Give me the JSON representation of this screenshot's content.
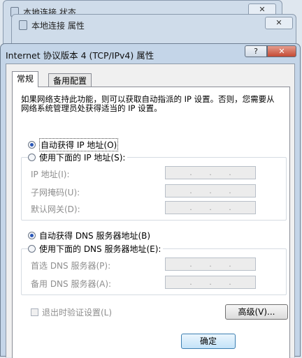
{
  "background_windows": [
    {
      "title": "本地连接 状态",
      "close_label": "✕"
    },
    {
      "title": "本地连接 属性",
      "close_label": "✕"
    }
  ],
  "dialog": {
    "title": "Internet 协议版本 4 (TCP/IPv4) 属性",
    "help_label": "?",
    "close_label": "✕"
  },
  "tabs": [
    {
      "label": "常规",
      "active": true
    },
    {
      "label": "备用配置",
      "active": false
    }
  ],
  "general": {
    "description": "如果网络支持此功能，则可以获取自动指派的 IP 设置。否则，您需要从网络系统管理员处获得适当的 IP 设置。",
    "ip_auto_label": "自动获得 IP 地址(O)",
    "ip_manual_label": "使用下面的 IP 地址(S):",
    "ip_fields": [
      {
        "label": "IP 地址(I):",
        "value": ". . ."
      },
      {
        "label": "子网掩码(U):",
        "value": ". . ."
      },
      {
        "label": "默认网关(D):",
        "value": ". . ."
      }
    ],
    "dns_auto_label": "自动获得 DNS 服务器地址(B)",
    "dns_manual_label": "使用下面的 DNS 服务器地址(E):",
    "dns_fields": [
      {
        "label": "首选 DNS 服务器(P):",
        "value": ". . ."
      },
      {
        "label": "备用 DNS 服务器(A):",
        "value": ". . ."
      }
    ],
    "validate_label": "退出时验证设置(L)",
    "advanced_label": "高级(V)...",
    "ok_label": "确定"
  },
  "state": {
    "ip_mode": "auto",
    "dns_mode": "auto",
    "validate_checked": false
  }
}
